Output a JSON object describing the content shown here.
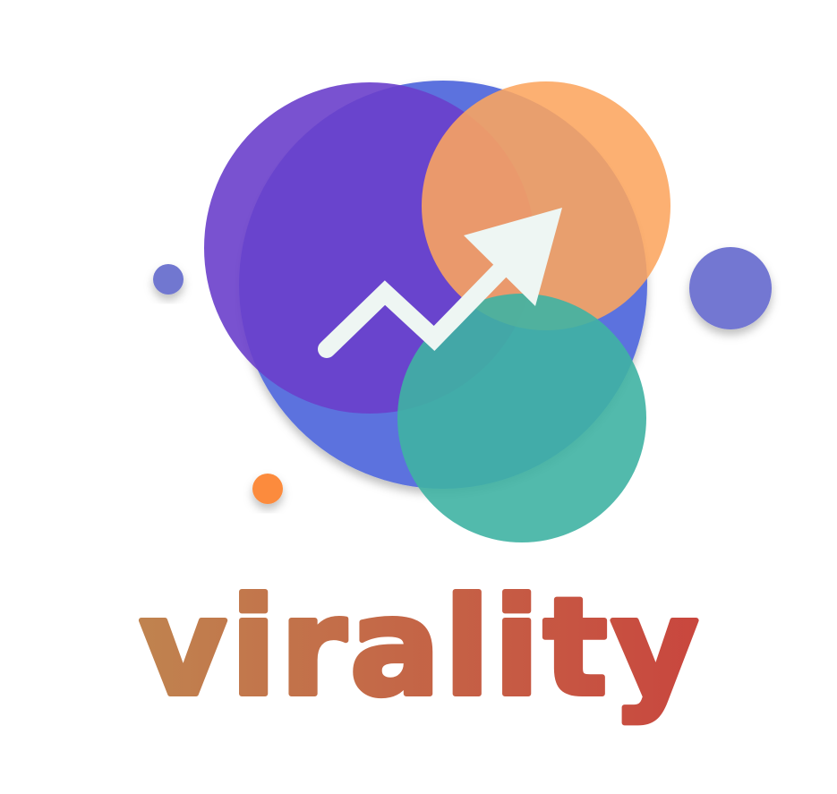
{
  "logo": {
    "wordmark": "virality",
    "icon": "trend-up-arrow-icon",
    "colors": {
      "purple": "#7650cf",
      "blue": "#5b72de",
      "orange": "#fca55e",
      "teal": "#45b5a6",
      "dot_purple": "#7177d0",
      "dot_orange": "#fc8b3c",
      "arrow": "#eef6f3",
      "text_start": "#c0834f",
      "text_end": "#c9463e"
    }
  }
}
